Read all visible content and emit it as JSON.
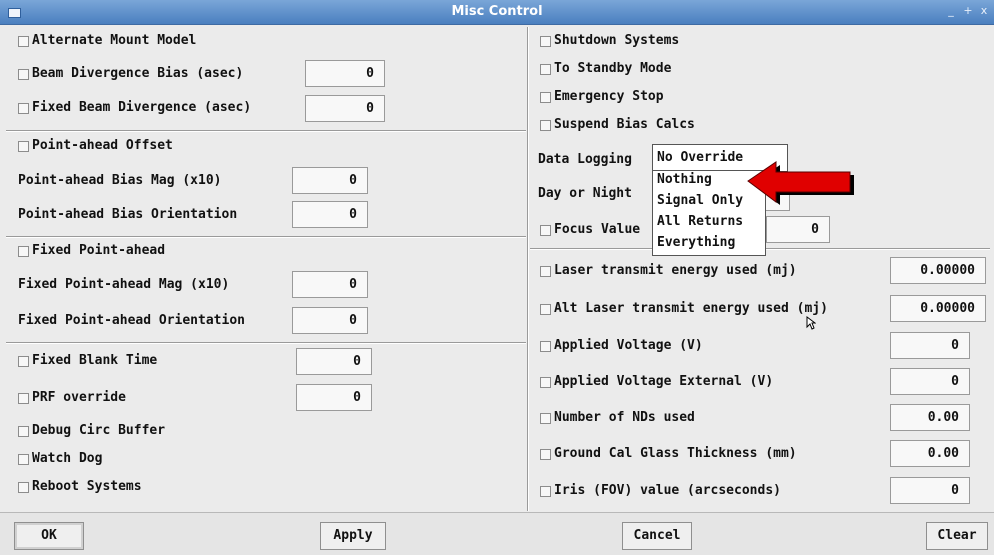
{
  "window": {
    "title": "Misc Control",
    "controls": [
      "_",
      "+",
      "x"
    ]
  },
  "left": {
    "alternate_mount_model": "Alternate Mount Model",
    "beam_divergence_bias": {
      "label": "Beam Divergence Bias  (asec)",
      "value": "0"
    },
    "fixed_beam_divergence": {
      "label": "Fixed Beam Divergence (asec)",
      "value": "0"
    },
    "point_ahead_offset": "Point-ahead Offset",
    "point_ahead_bias_mag": {
      "label": "Point-ahead Bias Mag (x10)",
      "value": "0"
    },
    "point_ahead_bias_orientation": {
      "label": "Point-ahead Bias Orientation",
      "value": "0"
    },
    "fixed_point_ahead": "Fixed Point-ahead",
    "fixed_point_ahead_mag": {
      "label": "Fixed Point-ahead Mag (x10)",
      "value": "0"
    },
    "fixed_point_ahead_orientation": {
      "label": "Fixed Point-ahead Orientation",
      "value": "0"
    },
    "fixed_blank_time": {
      "label": "Fixed Blank Time",
      "value": "0"
    },
    "prf_override": {
      "label": "PRF override",
      "value": "0"
    },
    "debug_circ_buffer": "Debug Circ Buffer",
    "watch_dog": "Watch Dog",
    "reboot_systems": "Reboot Systems"
  },
  "right": {
    "shutdown_systems": "Shutdown Systems",
    "to_standby_mode": "To Standby Mode",
    "emergency_stop": "Emergency Stop",
    "suspend_bias_calcs": "Suspend Bias Calcs",
    "data_logging": {
      "label": "Data Logging",
      "selected": "No Override"
    },
    "data_logging_options": [
      "Nothing",
      "Signal Only",
      "All Returns",
      "Everything"
    ],
    "day_or_night": "Day or Night",
    "focus_value": {
      "label": "Focus Value",
      "value": "0"
    },
    "laser_transmit_energy": {
      "label": "Laser transmit energy used (mj)",
      "value": "0.00000"
    },
    "alt_laser_transmit_energy": {
      "label": "Alt Laser transmit energy used (mj)",
      "value": "0.00000"
    },
    "applied_voltage": {
      "label": "Applied Voltage (V)",
      "value": "0"
    },
    "applied_voltage_external": {
      "label": "Applied Voltage External (V)",
      "value": "0"
    },
    "number_of_nds": {
      "label": "Number of NDs used",
      "value": "0.00"
    },
    "ground_cal_glass": {
      "label": "Ground Cal Glass Thickness (mm)",
      "value": "0.00"
    },
    "iris_fov": {
      "label": "Iris (FOV) value (arcseconds)",
      "value": "0"
    }
  },
  "buttons": {
    "ok": "OK",
    "apply": "Apply",
    "cancel": "Cancel",
    "clear": "Clear"
  },
  "colors": {
    "titlebar": "#5b8fcf",
    "panel": "#ebebeb",
    "arrow": "#e00000"
  }
}
